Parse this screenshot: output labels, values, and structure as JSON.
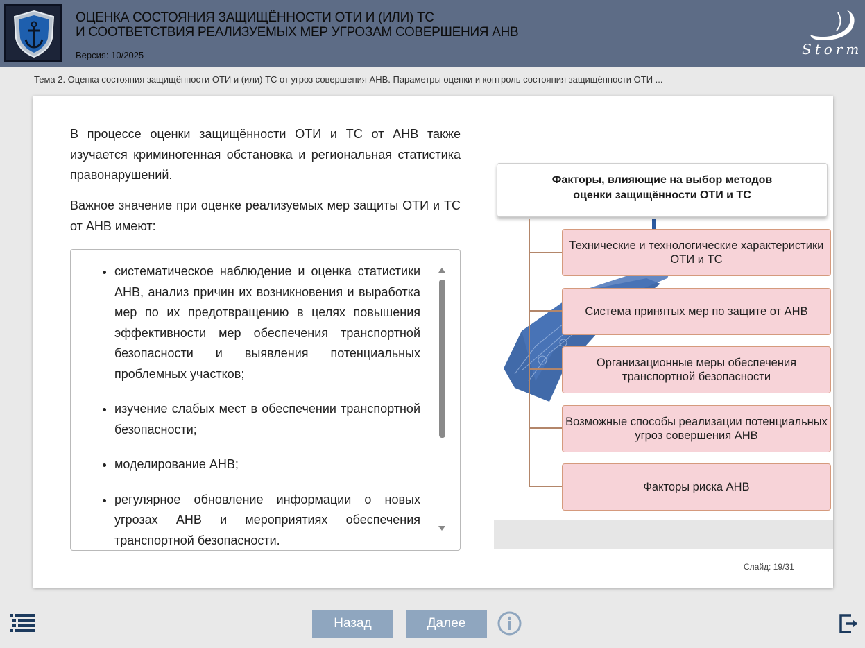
{
  "header": {
    "title_line1": "ОЦЕНКА СОСТОЯНИЯ ЗАЩИЩЁННОСТИ ОТИ И (ИЛИ) ТС",
    "title_line2": "И СООТВЕТСТВИЯ РЕАЛИЗУЕМЫХ МЕР УГРОЗАМ СОВЕРШЕНИЯ АНВ",
    "version": "Версия: 10/2025",
    "brand": "Storm"
  },
  "breadcrumb": "Тема 2. Оценка состояния защищённости ОТИ и (или) ТС от угроз совершения АНВ. Параметры оценки и контроль состояния защищённости ОТИ ...",
  "content": {
    "paragraph1": "В процессе оценки защищённости ОТИ и ТС от АНВ также изучается криминогенная обстановка и региональная статистика правонарушений.",
    "paragraph2": "Важное значение при оценке реализуемых мер защиты ОТИ и ТС от АНВ имеют:",
    "list": [
      "систематическое наблюдение и оценка статистики АНВ, анализ причин их возникновения и выработка мер по их предотвращению в целях повышения эффективности мер обеспечения транспортной безопасности и выявления потенциальных проблемных участков;",
      "изучение слабых мест в обеспечении транспортной безопасности;",
      "моделирование АНВ;",
      "регулярное обновление информации о новых угрозах АНВ и мероприятиях обеспечения транспортной безопасности."
    ]
  },
  "diagram": {
    "heading_line1": "Факторы, влияющие на выбор методов",
    "heading_line2": "оценки защищённости ОТИ и ТС",
    "factors": [
      "Технические и технологические характеристики ОТИ и ТС",
      "Система принятых мер по защите от АНВ",
      "Организационные меры обеспечения транспортной безопасности",
      "Возможные способы реализации потенциальных угроз совершения АНВ",
      "Факторы риска АНВ"
    ]
  },
  "slide_counter": "Слайд:  19/31",
  "nav": {
    "back": "Назад",
    "next": "Далее"
  },
  "colors": {
    "header_bg": "#5d6c86",
    "nav_button": "#8fa6bf",
    "factor_fill": "#f7d3d8",
    "factor_border": "#d59a7d"
  }
}
